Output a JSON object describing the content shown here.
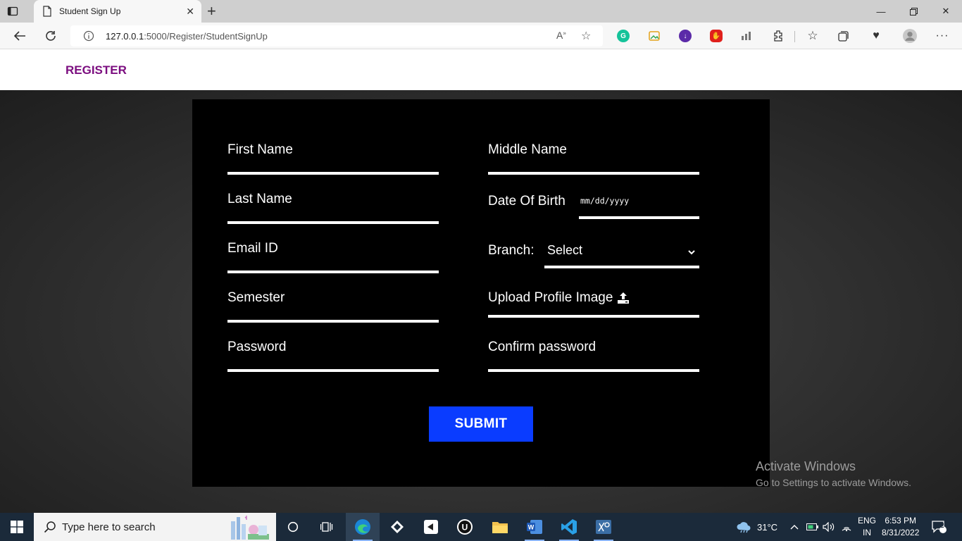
{
  "browser": {
    "tab_title": "Student Sign Up",
    "url_host": "127.0.0.1",
    "url_rest": ":5000/Register/StudentSignUp"
  },
  "page": {
    "brand": "REGISTER",
    "fields": {
      "first_name": "First Name",
      "middle_name": "Middle Name",
      "last_name": "Last Name",
      "dob": "Date Of Birth",
      "dob_placeholder": "mm/dd/yyyy",
      "email": "Email ID",
      "branch": "Branch:",
      "branch_selected": "Select",
      "semester": "Semester",
      "upload": "Upload Profile Image",
      "password": "Password",
      "confirm_password": "Confirm password"
    },
    "submit_label": "SUBMIT"
  },
  "watermark": {
    "title": "Activate Windows",
    "subtitle": "Go to Settings to activate Windows."
  },
  "taskbar": {
    "search_placeholder": "Type here to search",
    "weather": "31°C",
    "lang_top": "ENG",
    "lang_bottom": "IN",
    "time": "6:53 PM",
    "date": "8/31/2022",
    "notifications": "2"
  },
  "colors": {
    "brand": "#7b0d7f",
    "submit": "#0a3cff",
    "panel": "#000000"
  }
}
